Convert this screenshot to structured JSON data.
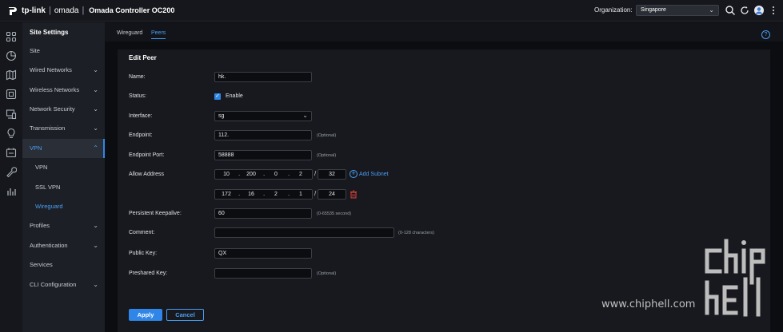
{
  "header": {
    "brand": "tp-link",
    "brand2": "omada",
    "app_title": "Omada Controller OC200",
    "org_label": "Organization:",
    "org_value": "Singapore",
    "icons": [
      "search-icon",
      "refresh-icon",
      "avatar-icon",
      "more-icon"
    ]
  },
  "rail": {
    "icons": [
      "dashboard-icon",
      "statistics-icon",
      "map-icon",
      "devices-icon",
      "clients-icon",
      "insights-icon",
      "log-icon",
      "tools-icon",
      "reports-icon"
    ]
  },
  "sidebar": {
    "title": "Site Settings",
    "items": [
      {
        "label": "Site",
        "chevron": ""
      },
      {
        "label": "Wired Networks",
        "chevron": "⌄"
      },
      {
        "label": "Wireless Networks",
        "chevron": "⌄"
      },
      {
        "label": "Network Security",
        "chevron": "⌄"
      },
      {
        "label": "Transmission",
        "chevron": "⌄"
      },
      {
        "label": "VPN",
        "chevron": "⌃"
      },
      {
        "label": "VPN",
        "chevron": ""
      },
      {
        "label": "SSL VPN",
        "chevron": ""
      },
      {
        "label": "Wireguard",
        "chevron": ""
      },
      {
        "label": "Profiles",
        "chevron": "⌄"
      },
      {
        "label": "Authentication",
        "chevron": "⌄"
      },
      {
        "label": "Services",
        "chevron": ""
      },
      {
        "label": "CLI Configuration",
        "chevron": "⌄"
      }
    ]
  },
  "tabs": [
    {
      "label": "Wireguard"
    },
    {
      "label": "Peers"
    }
  ],
  "help_label": "?",
  "form": {
    "title": "Edit Peer",
    "name_label": "Name:",
    "name_value": "hk.",
    "status_label": "Status:",
    "status_enable": "Enable",
    "interface_label": "Interface:",
    "interface_value": "sg",
    "endpoint_label": "Endpoint:",
    "endpoint_value": "112.",
    "endpoint_hint": "(Optional)",
    "endpoint_port_label": "Endpoint Port:",
    "endpoint_port_value": "58888",
    "endpoint_port_hint": "(Optional)",
    "allow_address_label": "Allow Address",
    "allow1": [
      "10",
      "200",
      "0",
      "2"
    ],
    "allow1_mask": "32",
    "allow2": [
      "172",
      "16",
      "2",
      "1"
    ],
    "allow2_mask": "24",
    "add_subnet": "Add Subnet",
    "keepalive_label": "Persistent Keepalive:",
    "keepalive_value": "60",
    "keepalive_hint": "(0-65535 second)",
    "comment_label": "Comment:",
    "comment_value": "",
    "comment_hint": "(0-128 characters)",
    "public_key_label": "Public Key:",
    "public_key_value": "QX",
    "preshared_key_label": "Preshared Key:",
    "preshared_key_value": "",
    "preshared_key_hint": "(Optional)",
    "apply": "Apply",
    "cancel": "Cancel"
  },
  "watermark": {
    "url": "www.chiphell.com",
    "logo_text": "chip hell"
  },
  "colors": {
    "accent": "#2f86e8",
    "delete": "#e0443e",
    "panel": "#17191e"
  }
}
